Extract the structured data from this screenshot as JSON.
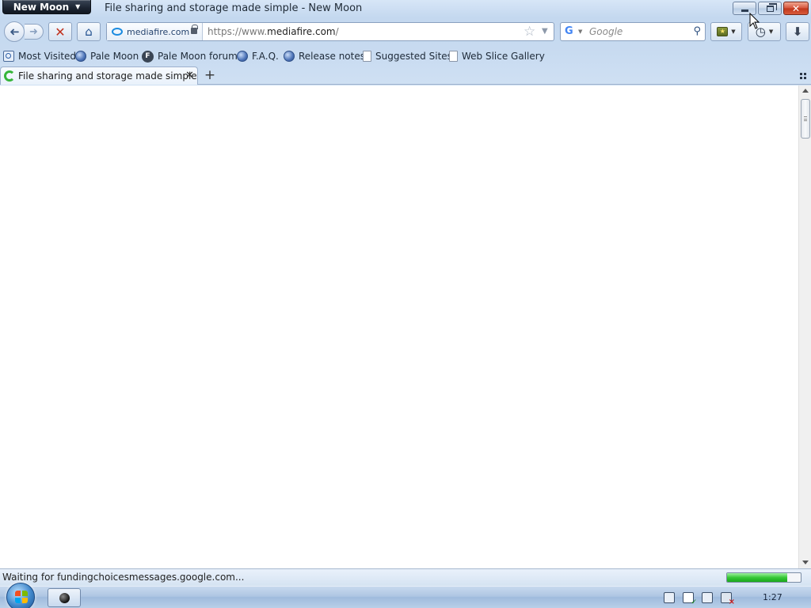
{
  "titlebar": {
    "app_button_label": "New Moon",
    "window_title": "File sharing and storage made simple - New Moon"
  },
  "navbar": {
    "identity_host": "mediafire.com",
    "url_prefix": "https://www.",
    "url_host": "mediafire.com",
    "url_suffix": "/",
    "search_placeholder": "Google",
    "search_engine_letter": "G"
  },
  "bookmarks": [
    {
      "label": "Most Visited",
      "icon": "most-visited-icon"
    },
    {
      "label": "Pale Moon",
      "icon": "globe-icon"
    },
    {
      "label": "Pale Moon forum",
      "icon": "forum-icon"
    },
    {
      "label": "F.A.Q.",
      "icon": "globe-icon"
    },
    {
      "label": "Release notes",
      "icon": "globe-icon"
    },
    {
      "label": "Suggested Sites",
      "icon": "page-icon"
    },
    {
      "label": "Web Slice Gallery",
      "icon": "page-icon"
    }
  ],
  "tabs": [
    {
      "label": "File sharing and storage made simple",
      "loading": true,
      "active": true
    }
  ],
  "statusbar": {
    "text": "Waiting for fundingchoicesmessages.google.com...",
    "progress": 0.82
  },
  "taskbar": {
    "clock": "1:27"
  },
  "colors": {
    "progress_fill": "#37c837",
    "close_button": "#c0361b",
    "stop_icon": "#c0301c"
  }
}
